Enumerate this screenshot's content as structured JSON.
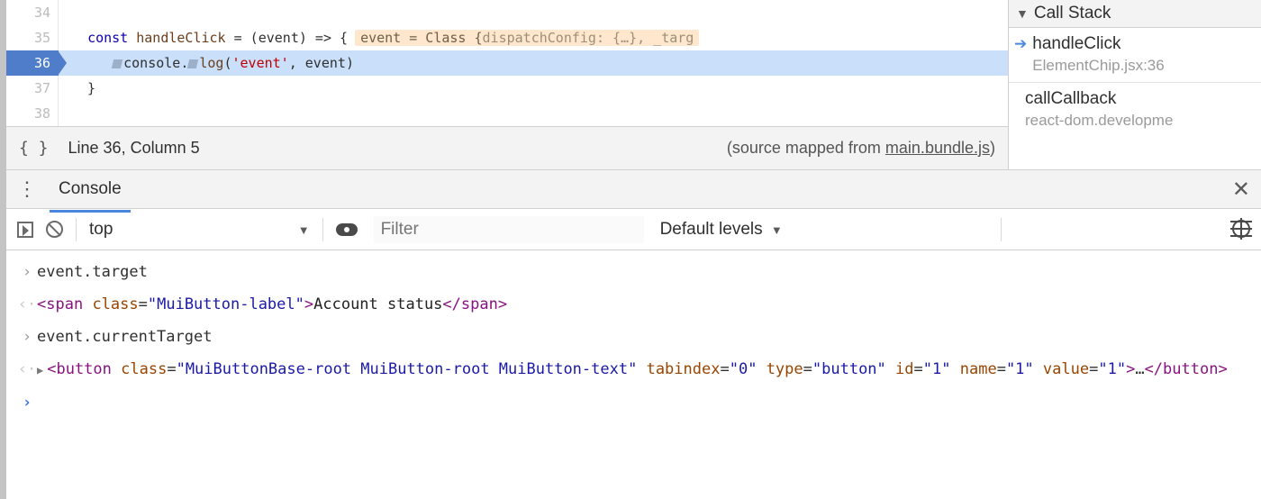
{
  "source": {
    "lines": [
      {
        "num": "34",
        "html": ""
      },
      {
        "num": "35",
        "html": "  <span class='kw'>const</span> <span class='fn'>handleClick</span> <span class='var'>= (event) =&gt; {</span><span class='pill'>event = Class {<span class='dim'>dispatchConfig: {…}, _targ</span></span>"
      },
      {
        "num": "36",
        "html": "    <span class='mk'></span><span class='var'>console.</span><span class='mk'></span><span class='fn'>log</span>(<span class='str'>'event'</span>, <span class='var'>event</span>)",
        "highlight": true
      },
      {
        "num": "37",
        "html": "  }"
      },
      {
        "num": "38",
        "html": ""
      }
    ],
    "status": {
      "position": "Line 36, Column 5",
      "mapped_prefix": "(source mapped from ",
      "mapped_file": "main.bundle.js",
      "mapped_suffix": ")"
    }
  },
  "callstack": {
    "title": "Call Stack",
    "frames": [
      {
        "name": "handleClick",
        "loc": "ElementChip.jsx:36",
        "active": true
      },
      {
        "name": "callCallback",
        "loc": "react-dom.developme"
      }
    ]
  },
  "console": {
    "tab_label": "Console",
    "toolbar": {
      "context": "top",
      "filter_placeholder": "Filter",
      "levels": "Default levels"
    },
    "rows": [
      {
        "kind": "in",
        "html": "event.target"
      },
      {
        "kind": "out",
        "html": "<span class='tok-tag'>&lt;span</span> <span class='tok-attr'>class</span>=<span class='tok-str'>\"MuiButton-label\"</span><span class='tok-tag'>&gt;</span><span class='tok-text'>Account status</span><span class='tok-tag'>&lt;/span&gt;</span>"
      },
      {
        "kind": "in",
        "html": "event.currentTarget"
      },
      {
        "kind": "out",
        "expandable": true,
        "html": "<span class='tok-tag'>&lt;button</span> <span class='tok-attr'>class</span>=<span class='tok-str'>\"MuiButtonBase-root MuiButton-root MuiButton-text\"</span> <span class='tok-attr'>tabindex</span>=<span class='tok-str'>\"0\"</span> <span class='tok-attr'>type</span>=<span class='tok-str'>\"button\"</span> <span class='tok-attr'>id</span>=<span class='tok-str'>\"1\"</span> <span class='tok-attr'>name</span>=<span class='tok-str'>\"1\"</span> <span class='tok-attr'>value</span>=<span class='tok-str'>\"1\"</span><span class='tok-tag'>&gt;</span>…<span class='tok-tag'>&lt;/button&gt;</span>"
      }
    ]
  }
}
